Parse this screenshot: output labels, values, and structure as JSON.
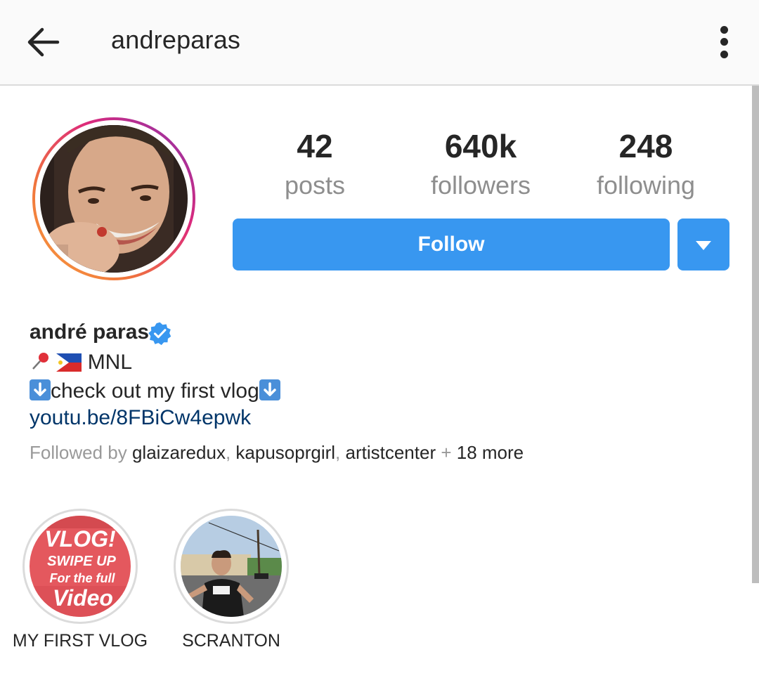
{
  "header": {
    "username": "andreparas",
    "back_icon": "arrow-left-icon",
    "menu_icon": "more-vertical-icon"
  },
  "profile": {
    "avatar_icon": "profile-photo",
    "stats": [
      {
        "count": "42",
        "label": "posts"
      },
      {
        "count": "640k",
        "label": "followers"
      },
      {
        "count": "248",
        "label": "following"
      }
    ],
    "follow_label": "Follow",
    "full_name": "andré paras",
    "verified": true
  },
  "bio": {
    "location": "MNL",
    "vlog_line": "check out my first vlog",
    "link": "youtu.be/8FBiCw4epwk"
  },
  "followed_by": {
    "prefix": "Followed by",
    "users": [
      "glaizaredux",
      "kapusoprgirl",
      "artistcenter"
    ],
    "more": "18 more"
  },
  "highlights": [
    {
      "label": "MY FIRST VLOG",
      "thumb_text": [
        "VLOG!",
        "SWIPE UP",
        "For the full",
        "Video"
      ]
    },
    {
      "label": "SCRANTON"
    }
  ],
  "colors": {
    "follow_blue": "#3897f0",
    "link_blue": "#003569",
    "verified_blue": "#3897f0",
    "muted_text": "#8e8e8e"
  }
}
